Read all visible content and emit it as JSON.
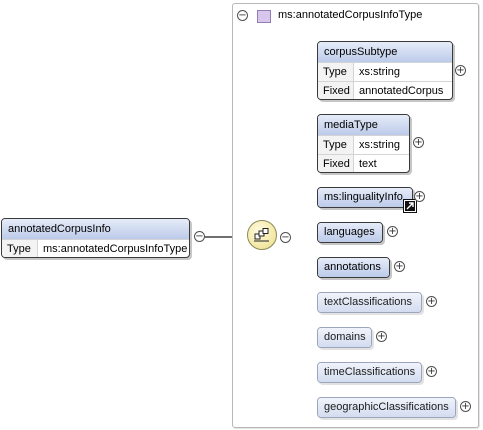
{
  "root": {
    "name": "annotatedCorpusInfo",
    "type_key": "Type",
    "type_value": "ms:annotatedCorpusInfoType"
  },
  "frame": {
    "title": "ms:annotatedCorpusInfoType",
    "collapse_symbol": "⊖"
  },
  "compositor": {
    "kind": "sequence",
    "icon": "sequence-icon"
  },
  "elements": [
    {
      "name": "corpusSubtype",
      "type_key": "Type",
      "type_value": "xs:string",
      "fixed_key": "Fixed",
      "fixed_value": "annotatedCorpus",
      "required": true
    },
    {
      "name": "mediaType",
      "type_key": "Type",
      "type_value": "xs:string",
      "fixed_key": "Fixed",
      "fixed_value": "text",
      "required": true
    },
    {
      "name": "ms:lingualityInfo",
      "required": true,
      "is_reference": true
    },
    {
      "name": "languages",
      "required": true
    },
    {
      "name": "annotations",
      "required": true
    },
    {
      "name": "textClassifications",
      "required": false
    },
    {
      "name": "domains",
      "required": false
    },
    {
      "name": "timeClassifications",
      "required": false
    },
    {
      "name": "geographicClassifications",
      "required": false
    }
  ],
  "symbols": {
    "collapse": "−",
    "expand": "+"
  },
  "colors": {
    "header_gradient_top": "#e6ecf8",
    "header_gradient_bottom": "#bccbea",
    "required_border": "#3a3a3a",
    "optional_border": "#9ba6bd",
    "required_connector": "#404040",
    "optional_connector": "#c8c8c8",
    "compositor_fill": "#f3e6a0"
  }
}
